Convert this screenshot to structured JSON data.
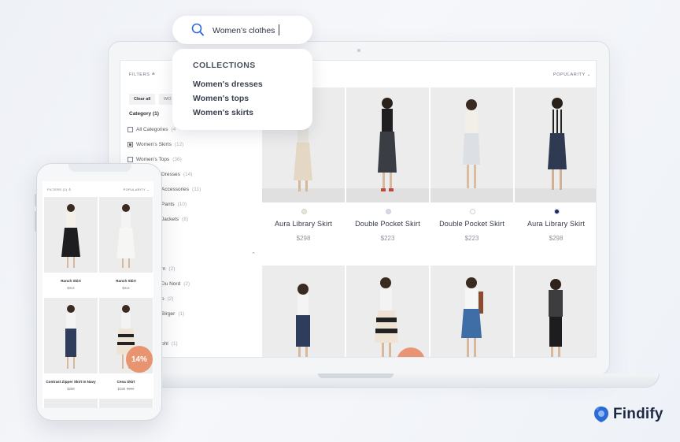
{
  "search": {
    "query": "Women's clothes",
    "collections_heading": "COLLECTIONS",
    "collections": [
      "Women's dresses",
      "Women's tops",
      "Women's skirts"
    ]
  },
  "desktop": {
    "filters_label": "FILTERS ≙",
    "sort_label": "POPULARITY",
    "chips": {
      "clear": "Clear all",
      "partial": "WO"
    },
    "category_heading": "Category (1)",
    "categories": [
      {
        "label": "All Categories",
        "count": "(4",
        "checked": false
      },
      {
        "label": "Women's Skirts",
        "count": "(12)",
        "checked": true
      },
      {
        "label": "Women's Tops",
        "count": "(36)",
        "checked": false
      },
      {
        "label": "Dresses",
        "count": "(14)",
        "checked": false
      },
      {
        "label": "Accessories",
        "count": "(11)",
        "checked": false
      },
      {
        "label": "Pants",
        "count": "(10)",
        "checked": false
      },
      {
        "label": "Jackets",
        "count": "(8)",
        "checked": false
      }
    ],
    "brands_partial": [
      {
        "label": "m",
        "count": "(2)"
      },
      {
        "label": "Du Nord",
        "count": "(2)"
      },
      {
        "label": "o",
        "count": "(2)"
      },
      {
        "label": "Birger",
        "count": "(1)"
      },
      {
        "label": "ohl",
        "count": "(1)"
      }
    ],
    "products": [
      {
        "name": "Aura Library Skirt",
        "price": "$298",
        "swatch": "#ede6cf"
      },
      {
        "name": "Double Pocket Skirt",
        "price": "$223",
        "swatch": "#d3dae4"
      },
      {
        "name": "Double Pocket Skirt",
        "price": "$223",
        "swatch": "#ffffff"
      },
      {
        "name": "Aura Library Skirt",
        "price": "$298",
        "swatch": "#1a2a6c"
      }
    ]
  },
  "mobile": {
    "filters_label": "FILTERS (2) ≙",
    "sort_label": "POPULARITY",
    "products": [
      {
        "name": "Ranch Skirt",
        "price": "$314",
        "old_price": ""
      },
      {
        "name": "Ranch Skirt",
        "price": "$314",
        "old_price": ""
      },
      {
        "name": "Contrast Zipper Skirt In Navy",
        "price": "$298",
        "old_price": ""
      },
      {
        "name": "Cena Skirt",
        "price": "$158",
        "old_price": "$184"
      }
    ],
    "discount_badge": "14%"
  },
  "brand": {
    "logo_text": "Findify",
    "accent": "#2c6bd6"
  }
}
